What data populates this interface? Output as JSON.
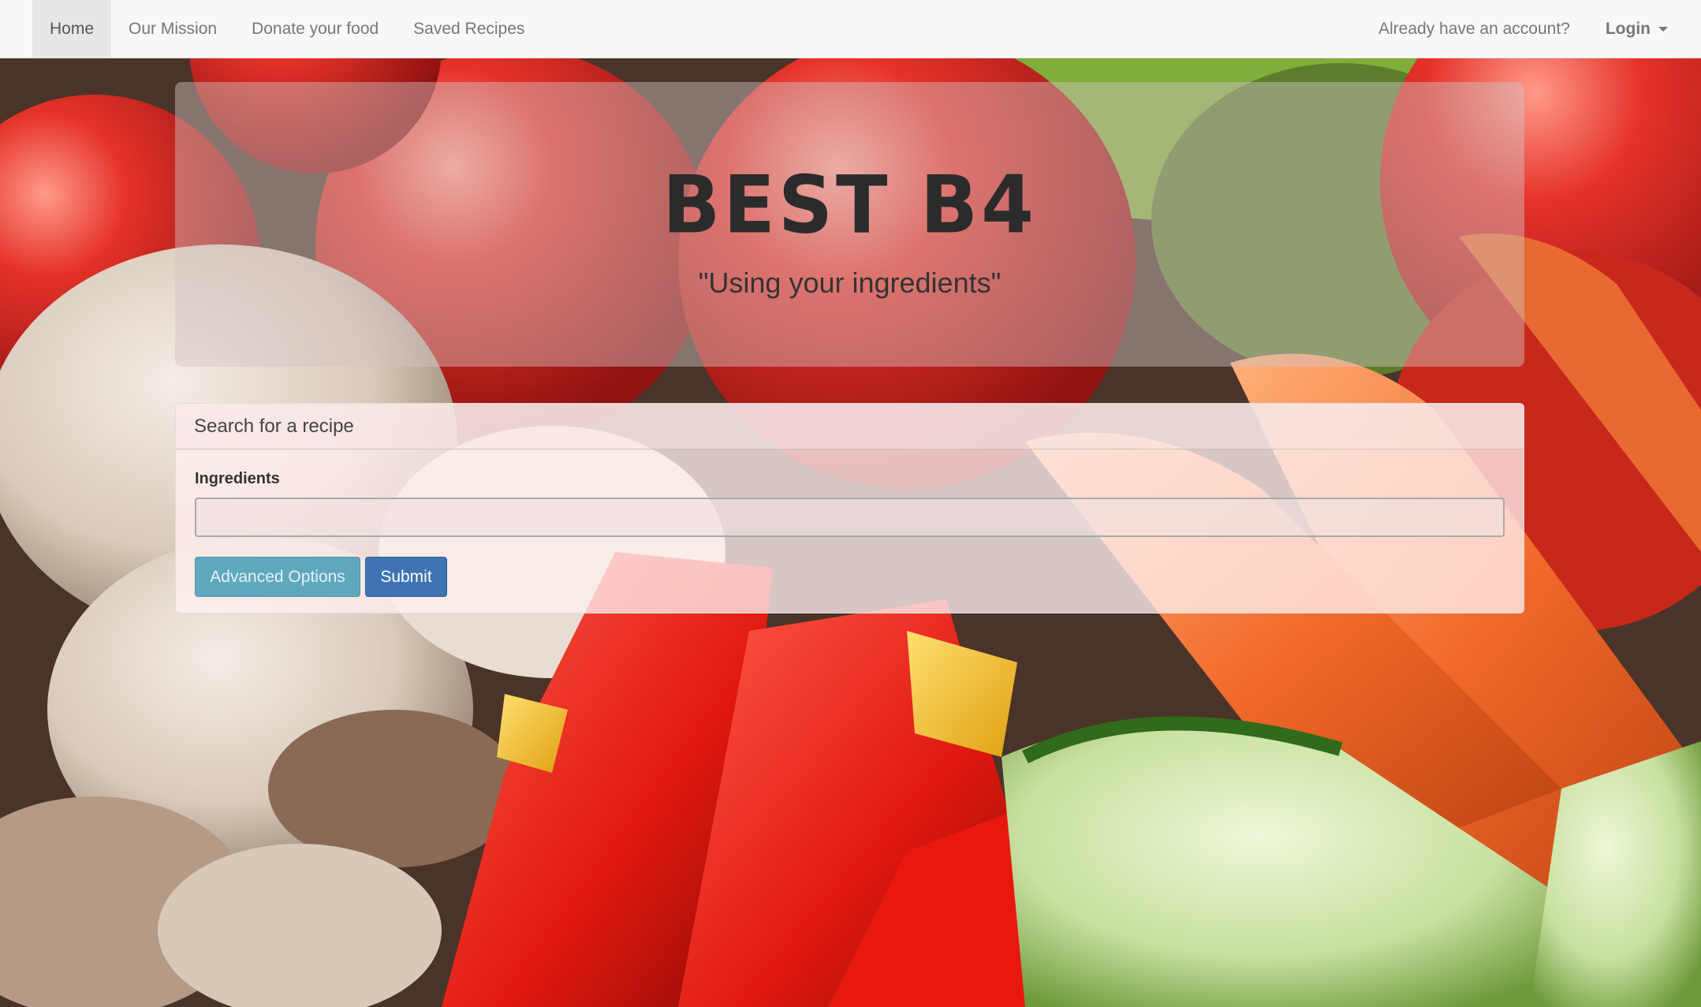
{
  "navbar": {
    "items": [
      {
        "label": "Home",
        "active": true
      },
      {
        "label": "Our Mission",
        "active": false
      },
      {
        "label": "Donate your food",
        "active": false
      },
      {
        "label": "Saved Recipes",
        "active": false
      }
    ],
    "account_prompt": "Already have an account?",
    "login_label": "Login",
    "login_icon": "caret-down-icon"
  },
  "hero": {
    "title": "BEST B4",
    "tagline": "\"Using your ingredients\""
  },
  "search_panel": {
    "heading": "Search for a recipe",
    "ingredients_label": "Ingredients",
    "ingredients_value": "",
    "ingredients_placeholder": "",
    "advanced_button": "Advanced Options",
    "submit_button": "Submit"
  },
  "colors": {
    "navbar_bg": "#f8f8f8",
    "advanced_button": "#5fa8bd",
    "submit_button": "#3f74b2",
    "title_text": "#2b2b2b"
  }
}
